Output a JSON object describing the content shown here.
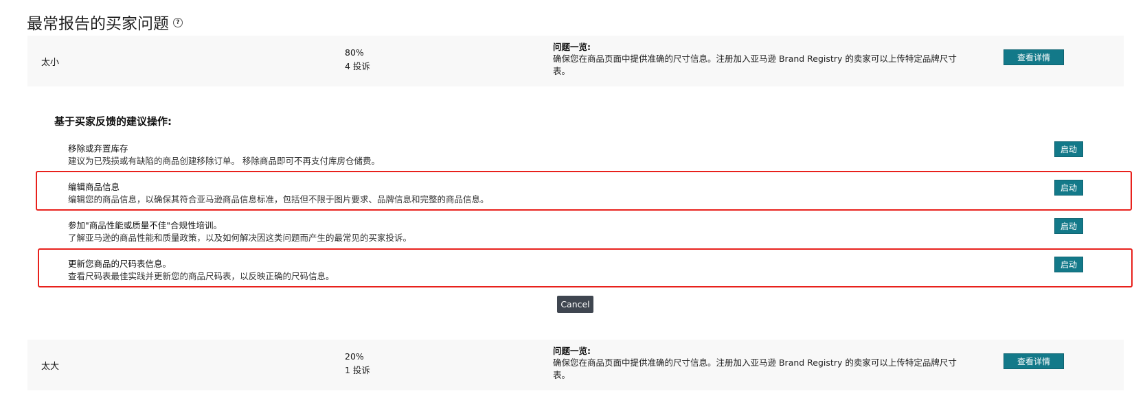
{
  "page": {
    "title": "最常报告的买家问题",
    "help_icon_glyph": "?"
  },
  "issues": [
    {
      "name": "太小",
      "percent": "80%",
      "complaints": "4 投诉",
      "overview_title": "问题一览:",
      "overview_text": "确保您在商品页面中提供准确的尺寸信息。注册加入亚马逊 Brand Registry 的卖家可以上传特定品牌尺寸表。",
      "details_label": "查看详情"
    },
    {
      "name": "太大",
      "percent": "20%",
      "complaints": "1 投诉",
      "overview_title": "问题一览:",
      "overview_text": "确保您在商品页面中提供准确的尺寸信息。注册加入亚马逊 Brand Registry 的卖家可以上传特定品牌尺寸表。",
      "details_label": "查看详情"
    }
  ],
  "recommendations": {
    "heading": "基于买家反馈的建议操作:",
    "actions": [
      {
        "title": "移除或弃置库存",
        "description": "建议为已残损或有缺陷的商品创建移除订单。 移除商品即可不再支付库房仓储费。",
        "button_label": "启动",
        "highlighted": false
      },
      {
        "title": "编辑商品信息",
        "description": "编辑您的商品信息，以确保其符合亚马逊商品信息标准，包括但不限于图片要求、品牌信息和完整的商品信息。",
        "button_label": "启动",
        "highlighted": true
      },
      {
        "title": "参加\"商品性能或质量不佳\"合规性培训。",
        "description": "了解亚马逊的商品性能和质量政策，以及如何解决因这类问题而产生的最常见的买家投诉。",
        "button_label": "启动",
        "highlighted": false
      },
      {
        "title": "更新您商品的尺码表信息。",
        "description": "查看尺码表最佳实践并更新您的商品尺码表，以反映正确的尺码信息。",
        "button_label": "启动",
        "highlighted": true
      }
    ],
    "cancel_label": "Cancel"
  },
  "colors": {
    "primary_button": "#137989",
    "cancel_button": "#3f4650",
    "highlight_border": "#e8211c",
    "row_background": "#f8f8f8"
  }
}
